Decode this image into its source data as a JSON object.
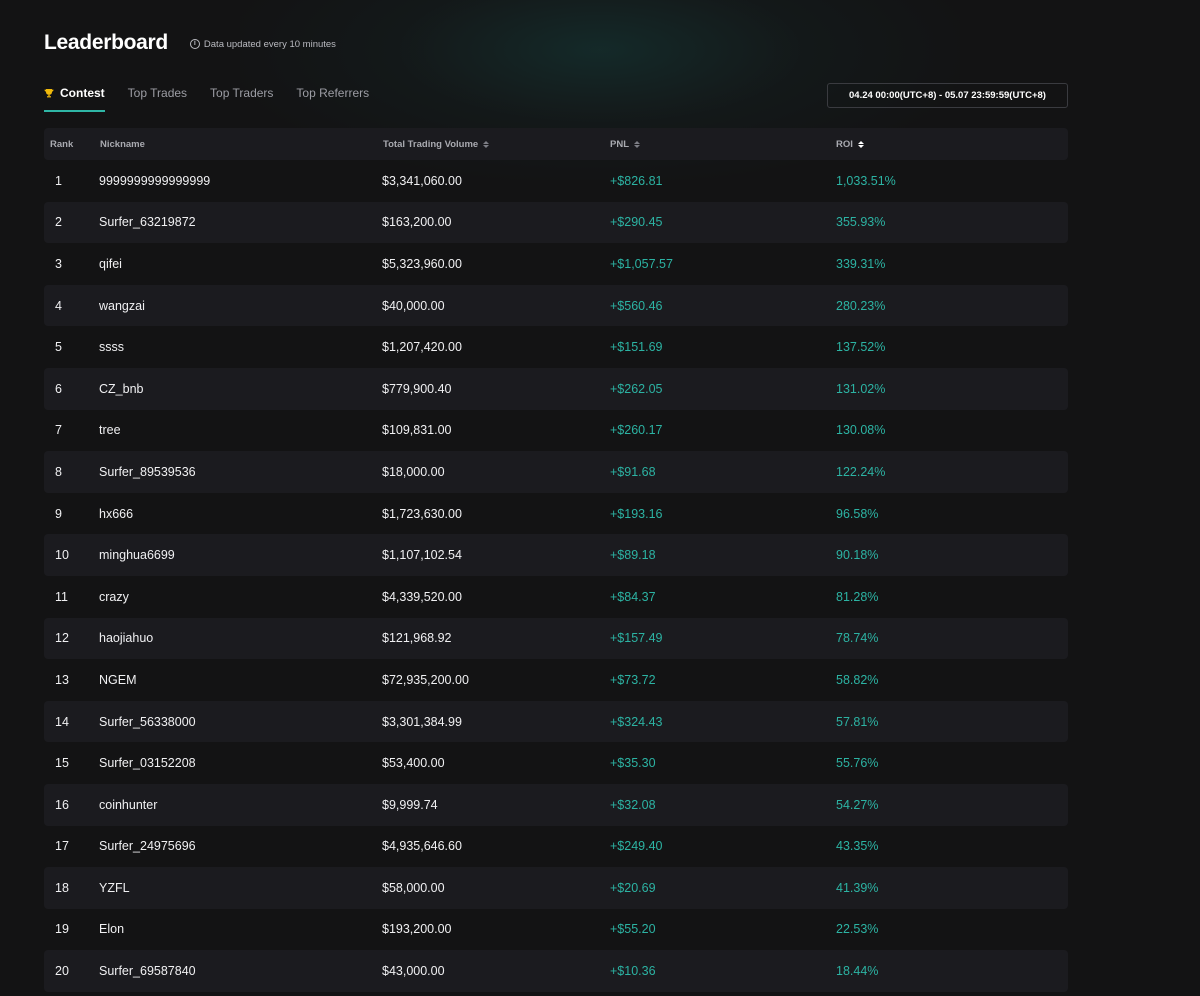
{
  "header": {
    "title": "Leaderboard",
    "update_note": "Data updated every 10 minutes"
  },
  "tabs": [
    {
      "label": "Contest",
      "active": true,
      "icon": "trophy-icon"
    },
    {
      "label": "Top Trades",
      "active": false
    },
    {
      "label": "Top Traders",
      "active": false
    },
    {
      "label": "Top Referrers",
      "active": false
    }
  ],
  "date_range": "04.24 00:00(UTC+8) - 05.07 23:59:59(UTC+8)",
  "table": {
    "columns": {
      "rank": "Rank",
      "nickname": "Nickname",
      "volume": "Total Trading Volume",
      "pnl": "PNL",
      "roi": "ROI"
    },
    "sorted_by": "roi",
    "sort_direction": "desc",
    "rows": [
      {
        "rank": "1",
        "nickname": "9999999999999999",
        "volume": "$3,341,060.00",
        "pnl": "+$826.81",
        "roi": "1,033.51%"
      },
      {
        "rank": "2",
        "nickname": "Surfer_63219872",
        "volume": "$163,200.00",
        "pnl": "+$290.45",
        "roi": "355.93%"
      },
      {
        "rank": "3",
        "nickname": "qifei",
        "volume": "$5,323,960.00",
        "pnl": "+$1,057.57",
        "roi": "339.31%"
      },
      {
        "rank": "4",
        "nickname": "wangzai",
        "volume": "$40,000.00",
        "pnl": "+$560.46",
        "roi": "280.23%"
      },
      {
        "rank": "5",
        "nickname": "ssss",
        "volume": "$1,207,420.00",
        "pnl": "+$151.69",
        "roi": "137.52%"
      },
      {
        "rank": "6",
        "nickname": "CZ_bnb",
        "volume": "$779,900.40",
        "pnl": "+$262.05",
        "roi": "131.02%"
      },
      {
        "rank": "7",
        "nickname": "tree",
        "volume": "$109,831.00",
        "pnl": "+$260.17",
        "roi": "130.08%"
      },
      {
        "rank": "8",
        "nickname": "Surfer_89539536",
        "volume": "$18,000.00",
        "pnl": "+$91.68",
        "roi": "122.24%"
      },
      {
        "rank": "9",
        "nickname": "hx666",
        "volume": "$1,723,630.00",
        "pnl": "+$193.16",
        "roi": "96.58%"
      },
      {
        "rank": "10",
        "nickname": "minghua6699",
        "volume": "$1,107,102.54",
        "pnl": "+$89.18",
        "roi": "90.18%"
      },
      {
        "rank": "11",
        "nickname": "crazy",
        "volume": "$4,339,520.00",
        "pnl": "+$84.37",
        "roi": "81.28%"
      },
      {
        "rank": "12",
        "nickname": "haojiahuo",
        "volume": "$121,968.92",
        "pnl": "+$157.49",
        "roi": "78.74%"
      },
      {
        "rank": "13",
        "nickname": "NGEM",
        "volume": "$72,935,200.00",
        "pnl": "+$73.72",
        "roi": "58.82%"
      },
      {
        "rank": "14",
        "nickname": "Surfer_56338000",
        "volume": "$3,301,384.99",
        "pnl": "+$324.43",
        "roi": "57.81%"
      },
      {
        "rank": "15",
        "nickname": "Surfer_03152208",
        "volume": "$53,400.00",
        "pnl": "+$35.30",
        "roi": "55.76%"
      },
      {
        "rank": "16",
        "nickname": "coinhunter",
        "volume": "$9,999.74",
        "pnl": "+$32.08",
        "roi": "54.27%"
      },
      {
        "rank": "17",
        "nickname": "Surfer_24975696",
        "volume": "$4,935,646.60",
        "pnl": "+$249.40",
        "roi": "43.35%"
      },
      {
        "rank": "18",
        "nickname": "YZFL",
        "volume": "$58,000.00",
        "pnl": "+$20.69",
        "roi": "41.39%"
      },
      {
        "rank": "19",
        "nickname": "Elon",
        "volume": "$193,200.00",
        "pnl": "+$55.20",
        "roi": "22.53%"
      },
      {
        "rank": "20",
        "nickname": "Surfer_69587840",
        "volume": "$43,000.00",
        "pnl": "+$10.36",
        "roi": "18.44%"
      }
    ]
  },
  "colors": {
    "background": "#131314",
    "row_alt": "#1b1b1f",
    "accent": "#2fb6a6",
    "positive": "#2cb3a3",
    "trophy": "#f0b90b"
  }
}
